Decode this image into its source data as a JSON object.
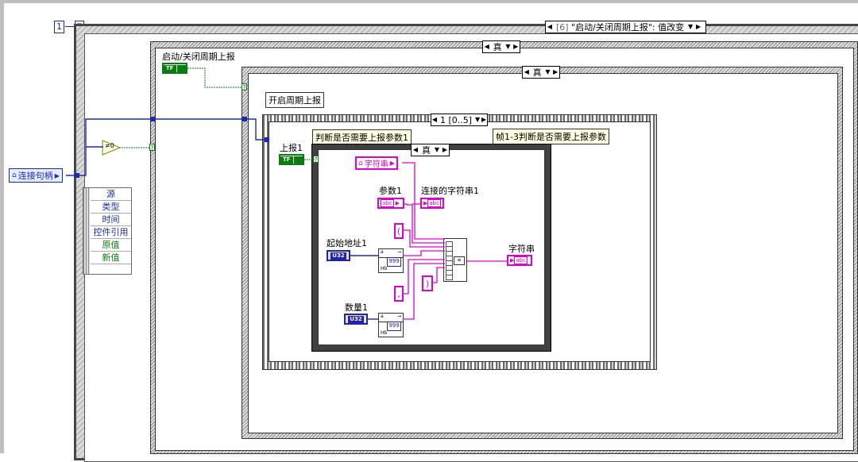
{
  "sequence_frame": {
    "index": "1",
    "marker": "⊠"
  },
  "event_selector": {
    "index": "[6]",
    "text": "\"启动/关闭周期上报\": 值改变"
  },
  "event_data_node": {
    "rows": [
      {
        "label": "源",
        "color": "#1a2ab8"
      },
      {
        "label": "类型",
        "color": "#1a2ab8"
      },
      {
        "label": "时间",
        "color": "#1a2ab8"
      },
      {
        "label": "控件引用",
        "color": "#1a2ab8"
      },
      {
        "label": "原值",
        "color": "#0a7d12"
      },
      {
        "label": "新值",
        "color": "#0a7d12"
      }
    ]
  },
  "connection_refnum": {
    "label": "连接句柄"
  },
  "not_equal_zero": {
    "glyph": "≠0"
  },
  "outer_case": {
    "selector": "真"
  },
  "inner_case": {
    "selector": "真"
  },
  "innermost_case": {
    "selector": "真"
  },
  "bool_control_main": {
    "label": "启动/关闭周期上报",
    "glyph": "TF"
  },
  "start_label": "开启周期上报",
  "stacked_sequence": {
    "selector": "1 [0..5]"
  },
  "report1": {
    "label": "上报1",
    "glyph": "TF"
  },
  "judge_label": "判断是否需要上报参数1",
  "frame_comment": "帧1-3判断是否需要上报参数",
  "string_local": {
    "label": "字符串"
  },
  "param1": {
    "label": "参数1",
    "glyph": "abc"
  },
  "concat_string1": {
    "label": "连接的字符串1",
    "glyph": "abc"
  },
  "paren_open": "(",
  "paren_close": ")",
  "comma": ",",
  "start_address": {
    "label": "起始地址1",
    "glyph": "U32"
  },
  "quantity": {
    "label": "数量1",
    "glyph": "U32"
  },
  "number_format": {
    "left": "a",
    "display": "999",
    "bottom": "Hb"
  },
  "output_string": {
    "label": "字符串",
    "glyph": "abc"
  },
  "colors": {
    "string_wire": "#e000d0",
    "numeric_wire": "#1a2ab8",
    "bool_wire": "#0a7d12"
  }
}
